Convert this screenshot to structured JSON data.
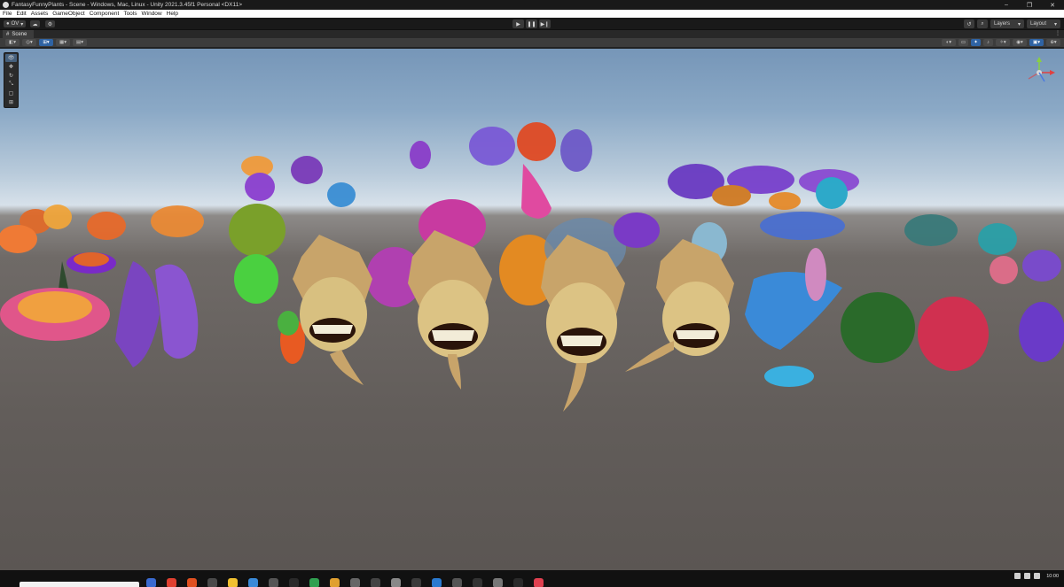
{
  "window": {
    "title": "FantasyFunnyPlants - Scene - Windows, Mac, Linux - Unity 2021.3.45f1 Personal <DX11>",
    "minimize": "–",
    "maximize": "❐",
    "close": "✕"
  },
  "menu": {
    "items": [
      "File",
      "Edit",
      "Assets",
      "GameObject",
      "Component",
      "Tools",
      "Window",
      "Help"
    ]
  },
  "toolbar": {
    "account_label": "OV",
    "play": "▶",
    "pause": "❚❚",
    "step": "▶❙",
    "layers_label": "Layers",
    "layout_label": "Layout"
  },
  "scene_tab": {
    "label": "Scene",
    "more": "⋮"
  },
  "taskbar": {
    "time": "10:00"
  }
}
